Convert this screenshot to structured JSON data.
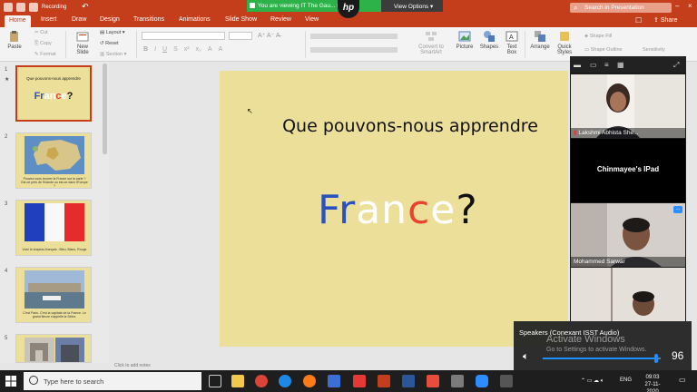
{
  "titlebar": {
    "doc_title": "Recording",
    "search_placeholder": "Search in Presentation"
  },
  "zoom": {
    "share_banner": "You are viewing IT The Gau... reen",
    "view_options": "View Options",
    "logo": "hp"
  },
  "tabs": [
    "Home",
    "Insert",
    "Draw",
    "Design",
    "Transitions",
    "Animations",
    "Slide Show",
    "Review",
    "View"
  ],
  "share_label": "Share",
  "ribbon": {
    "paste": "Paste",
    "cut": "Cut",
    "copy": "Copy",
    "format": "Format",
    "new_slide": "New Slide",
    "layout": "Layout",
    "reset": "Reset",
    "section": "Section",
    "convert": "Convert to SmartArt",
    "picture": "Picture",
    "shapes": "Shapes",
    "text_box": "Text Box",
    "arrange": "Arrange",
    "quick_styles": "Quick Styles",
    "shape_fill": "Shape Fill",
    "shape_outline": "Shape Outline",
    "sensitivity": "Sensitivity",
    "format_buttons": [
      "B",
      "I",
      "U",
      "S",
      "x²",
      "x₂",
      "A",
      "A"
    ]
  },
  "slides": [
    {
      "num": "1",
      "title": "Que pouvons-nous apprendre",
      "word": "France?"
    },
    {
      "num": "2",
      "caption": "Pouvez-vous trouver la France sur la carte ? Est-ce près de l'Irlande ou est-ce dans l'Europe ?"
    },
    {
      "num": "3",
      "caption": "Voici le drapeau français : Bleu, Blanc, Rouge"
    },
    {
      "num": "4",
      "caption": "C'est Paris. C'est la capitale de la France. Le grand fleuve s'appelle la Seine."
    },
    {
      "num": "5"
    }
  ],
  "main_slide": {
    "title": "Que pouvons-nous apprendre",
    "word_letters": [
      {
        "ch": "F",
        "color": "#2a52be"
      },
      {
        "ch": "r",
        "color": "#2a52be"
      },
      {
        "ch": "a",
        "color": "#ffffff"
      },
      {
        "ch": "n",
        "color": "#ffffff"
      },
      {
        "ch": "c",
        "color": "#e8442f"
      },
      {
        "ch": "e",
        "color": "#ffffff"
      },
      {
        "ch": "?",
        "color": "#111111"
      }
    ]
  },
  "notes_hint": "Click to add notes",
  "gallery": {
    "participants": [
      {
        "name": "Lakshmi Abhista She..."
      },
      {
        "name": "Chinmayee's IPad"
      },
      {
        "name": "Mohammed Sarwar"
      },
      {
        "name": ""
      }
    ],
    "more_label": "..."
  },
  "speakers": {
    "label": "Speakers (Conexant ISST Audio)",
    "watermark_title": "Activate Windows",
    "watermark_sub": "Go to Settings to activate Windows.",
    "volume_value": "96",
    "volume_fraction": 0.96
  },
  "taskbar": {
    "search_placeholder": "Type here to search",
    "lang": "ENG",
    "time": "09:03",
    "date": "27-11-2020"
  },
  "colors": {
    "accent": "#c43e1c",
    "zoom_green": "#2db24a",
    "slide_bg": "#ecdf9a"
  }
}
